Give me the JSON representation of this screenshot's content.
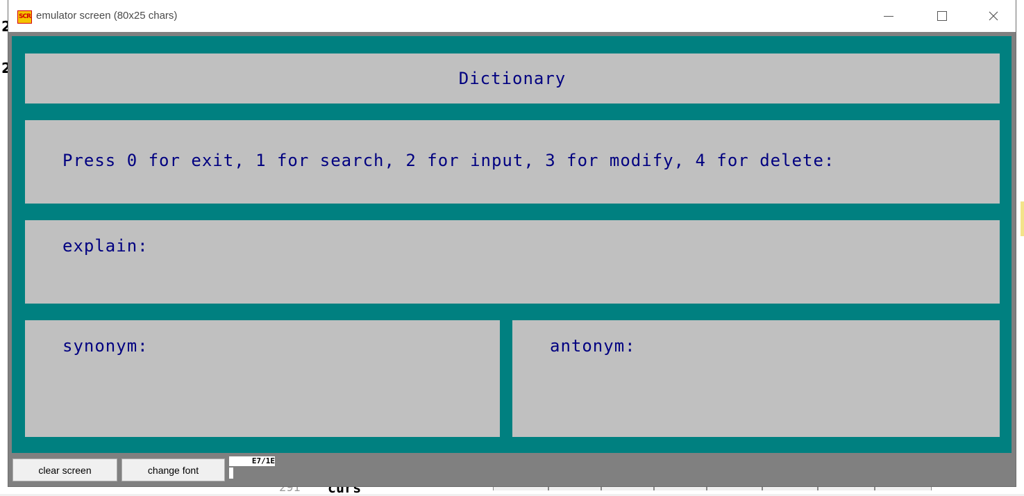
{
  "window": {
    "title": "emulator screen (80x25 chars)",
    "icon_label": "SCR",
    "controls": {
      "minimize": "minimize-icon",
      "maximize": "maximize-icon",
      "close": "close-icon"
    }
  },
  "screen": {
    "title": "Dictionary",
    "menu_prompt": "Press 0 for exit, 1 for search, 2 for input, 3 for modify, 4 for delete:",
    "explain_label": "explain:",
    "synonym_label": "synonym:",
    "antonym_label": "antonym:"
  },
  "bottom_bar": {
    "clear_button": "clear screen",
    "font_button": "change font",
    "indicator": "E7/1E"
  },
  "background": {
    "line_number": "291",
    "code_fragment": "curs",
    "left_digits": [
      "2",
      "2"
    ]
  },
  "colors": {
    "screen_bg": "#008080",
    "panel_bg": "#c0c0c0",
    "text": "#000080"
  }
}
